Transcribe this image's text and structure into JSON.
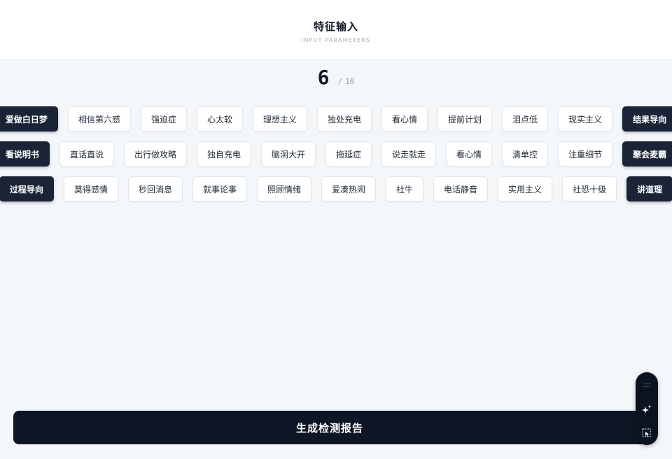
{
  "header": {
    "title": "特征输入",
    "subtitle": "INPUT PARAMETERS"
  },
  "counter": {
    "current": "6",
    "separator": "/",
    "total": "10"
  },
  "rows": [
    [
      {
        "label": "爱做白日梦",
        "selected": true
      },
      {
        "label": "相信第六感",
        "selected": false
      },
      {
        "label": "强迫症",
        "selected": false
      },
      {
        "label": "心太软",
        "selected": false
      },
      {
        "label": "理想主义",
        "selected": false
      },
      {
        "label": "独处充电",
        "selected": false
      },
      {
        "label": "看心情",
        "selected": false
      },
      {
        "label": "提前计划",
        "selected": false
      },
      {
        "label": "泪点低",
        "selected": false
      },
      {
        "label": "现实主义",
        "selected": false
      },
      {
        "label": "结果导向",
        "selected": true
      }
    ],
    [
      {
        "label": "看说明书",
        "selected": true
      },
      {
        "label": "直话直说",
        "selected": false
      },
      {
        "label": "出行做攻略",
        "selected": false
      },
      {
        "label": "独自充电",
        "selected": false
      },
      {
        "label": "脑洞大开",
        "selected": false
      },
      {
        "label": "拖延症",
        "selected": false
      },
      {
        "label": "说走就走",
        "selected": false
      },
      {
        "label": "看心情",
        "selected": false
      },
      {
        "label": "清单控",
        "selected": false
      },
      {
        "label": "注重细节",
        "selected": false
      },
      {
        "label": "聚会麦霸",
        "selected": true
      }
    ],
    [
      {
        "label": "过程导向",
        "selected": true
      },
      {
        "label": "莫得感情",
        "selected": false
      },
      {
        "label": "秒回消息",
        "selected": false
      },
      {
        "label": "就事论事",
        "selected": false
      },
      {
        "label": "照顾情绪",
        "selected": false
      },
      {
        "label": "爱凑热闹",
        "selected": false
      },
      {
        "label": "社牛",
        "selected": false
      },
      {
        "label": "电话静音",
        "selected": false
      },
      {
        "label": "实用主义",
        "selected": false
      },
      {
        "label": "社恐十级",
        "selected": false
      },
      {
        "label": "讲道理",
        "selected": true
      }
    ]
  ],
  "generate_button": {
    "label": "生成检测报告"
  },
  "toolbar": {
    "icons": [
      "grip-icon",
      "sparkle-icon",
      "select-pointer-icon"
    ]
  },
  "colors": {
    "selected_chip": "#1a2436",
    "button": "#0e1626",
    "background": "#f4f7f9"
  }
}
